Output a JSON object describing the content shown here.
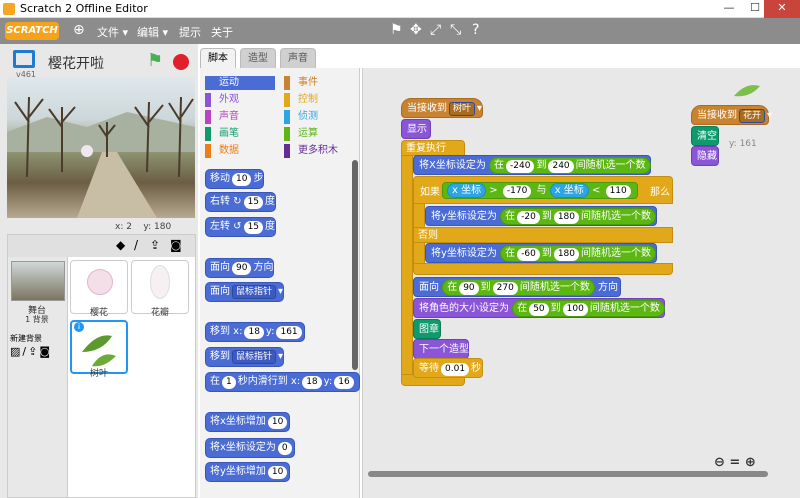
{
  "window": {
    "title": "Scratch 2 Offline Editor",
    "min": "—",
    "max": "☐",
    "close": "✕"
  },
  "menubar": {
    "logo": "SCRATCH",
    "items": [
      "文件 ▾",
      "编辑 ▾",
      "提示",
      "关于"
    ],
    "tools": [
      "⚑",
      "✥",
      "⤢",
      "⤡",
      "?"
    ]
  },
  "sprite": {
    "name": "樱花开啦",
    "version": "v461",
    "x_label": "x:",
    "x": "2",
    "y_label": "y:",
    "y": "180"
  },
  "sprites_panel": {
    "stage_label": "舞台",
    "stage_sub": "1 背景",
    "new_backdrop": "新建背景",
    "sprites": [
      "樱花",
      "花瓣",
      "树叶"
    ]
  },
  "tabs": [
    "脚本",
    "造型",
    "声音"
  ],
  "categories": [
    {
      "label": "运动",
      "color": "#4a6cd4",
      "active": true
    },
    {
      "label": "事件",
      "color": "#c88330"
    },
    {
      "label": "外观",
      "color": "#8a55d7"
    },
    {
      "label": "控制",
      "color": "#e1a91a"
    },
    {
      "label": "声音",
      "color": "#bb42c3"
    },
    {
      "label": "侦测",
      "color": "#2ca5e2"
    },
    {
      "label": "画笔",
      "color": "#0e9a6c"
    },
    {
      "label": "运算",
      "color": "#5cb712"
    },
    {
      "label": "数据",
      "color": "#ee7d16"
    },
    {
      "label": "更多积木",
      "color": "#632d99"
    }
  ],
  "palette": {
    "move": "移动",
    "move_v": "10",
    "move_u": "步",
    "turn_r": "右转",
    "turn_r_v": "15",
    "turn_r_u": "度",
    "turn_l": "左转",
    "turn_l_v": "15",
    "turn_l_u": "度",
    "face": "面向",
    "face_v": "90",
    "face_u": "方向",
    "face_to": "面向",
    "face_to_v": "鼠标指针",
    "goto": "移到 x:",
    "goto_x": "18",
    "goto_y_l": "y:",
    "goto_y": "161",
    "goto_to": "移到",
    "goto_to_v": "鼠标指针",
    "glide_a": "在",
    "glide_v": "1",
    "glide_b": "秒内滑行到 x:",
    "glide_x": "18",
    "glide_y_l": "y:",
    "glide_y": "16",
    "chx": "将x坐标增加",
    "chx_v": "10",
    "setx": "将x坐标设定为",
    "setx_v": "0",
    "chy": "将y坐标增加",
    "chy_v": "10"
  },
  "script": {
    "hat": "当接收到",
    "hat_msg": "树叶",
    "show": "显示",
    "forever": "重复执行",
    "setx": "将X坐标设定为",
    "rand_a": "在",
    "rand_to": "到",
    "rand_b": "间随机选一个数",
    "setx_lo": "-240",
    "setx_hi": "240",
    "if": "如果",
    "xpos": "x 坐标",
    "gt": ">",
    "v170": "-170",
    "and": "与",
    "lt": "<",
    "v110": "110",
    "then": "那么",
    "sety1": "将y坐标设定为",
    "sety1_lo": "-20",
    "sety1_hi": "180",
    "else": "否则",
    "sety2": "将y坐标设定为",
    "sety2_lo": "-60",
    "sety2_hi": "180",
    "face": "面向",
    "face_lo": "90",
    "face_hi": "270",
    "face_u": "方向",
    "size": "将角色的大小设定为",
    "size_lo": "50",
    "size_hi": "100",
    "stamp": "图章",
    "nextcos": "下一个造型",
    "wait": "等待",
    "wait_v": "0.01",
    "wait_u": "秒",
    "hat2": "当接收到",
    "hat2_msg": "花开",
    "clear": "清空",
    "hide": "隐藏",
    "ghost_y": "y: 161"
  },
  "zoom": "⊖ = ⊕"
}
